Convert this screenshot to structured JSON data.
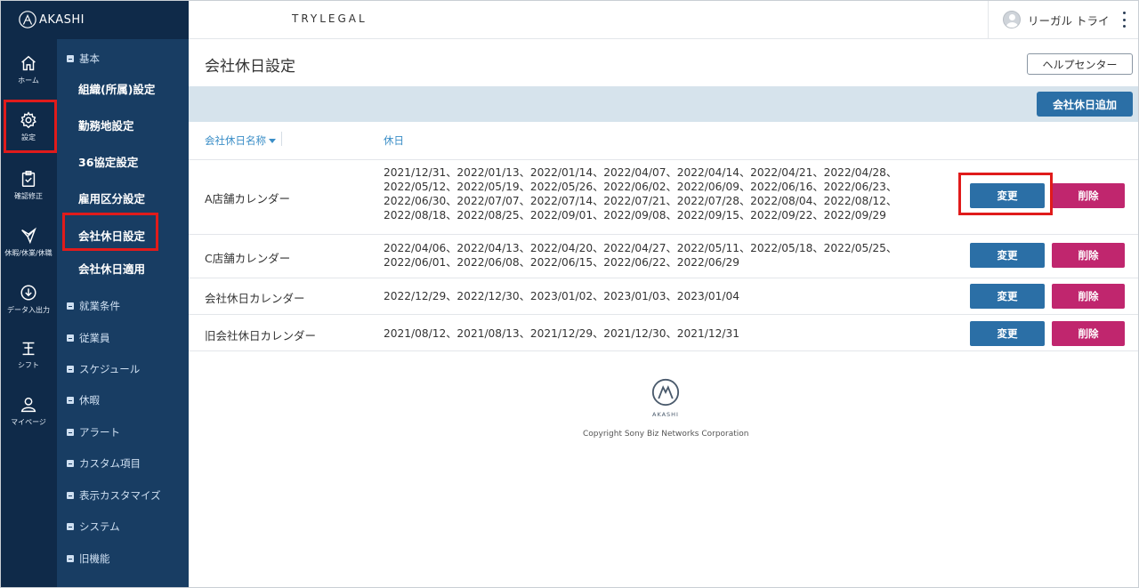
{
  "app": {
    "logo_text": "AKASHI",
    "brand": "TRYLEGAL"
  },
  "user": {
    "name": "リーガル トライ"
  },
  "rail": {
    "items": [
      {
        "label": "ホーム",
        "icon": "home-icon"
      },
      {
        "label": "設定",
        "icon": "gear-icon"
      },
      {
        "label": "確認修正",
        "icon": "clipboard-icon"
      },
      {
        "label": "休暇/休業/休職",
        "icon": "leave-icon"
      },
      {
        "label": "データ入出力",
        "icon": "download-icon"
      },
      {
        "label": "シフト",
        "icon": "shift-icon"
      },
      {
        "label": "マイページ",
        "icon": "person-icon"
      }
    ]
  },
  "sidebar": {
    "basic_section": "基本",
    "basic_items": [
      "組織(所属)設定",
      "勤務地設定",
      "36協定設定",
      "雇用区分設定",
      "会社休日設定",
      "会社休日適用"
    ],
    "sections": [
      "就業条件",
      "従業員",
      "スケジュール",
      "休暇",
      "アラート",
      "カスタム項目",
      "表示カスタマイズ",
      "システム",
      "旧機能"
    ]
  },
  "main": {
    "title": "会社休日設定",
    "help_button": "ヘルプセンター",
    "add_button": "会社休日追加",
    "col_name": "会社休日名称",
    "col_holidays": "休日",
    "edit_label": "変更",
    "delete_label": "削除"
  },
  "rows": [
    {
      "name": "A店舗カレンダー",
      "lines": [
        "2021/12/31、2022/01/13、2022/01/14、2022/04/07、2022/04/14、2022/04/21、2022/04/28、",
        "2022/05/12、2022/05/19、2022/05/26、2022/06/02、2022/06/09、2022/06/16、2022/06/23、",
        "2022/06/30、2022/07/07、2022/07/14、2022/07/21、2022/07/28、2022/08/04、2022/08/12、",
        "2022/08/18、2022/08/25、2022/09/01、2022/09/08、2022/09/15、2022/09/22、2022/09/29"
      ]
    },
    {
      "name": "C店舗カレンダー",
      "lines": [
        "2022/04/06、2022/04/13、2022/04/20、2022/04/27、2022/05/11、2022/05/18、2022/05/25、",
        "2022/06/01、2022/06/08、2022/06/15、2022/06/22、2022/06/29"
      ]
    },
    {
      "name": "会社休日カレンダー",
      "lines": [
        "2022/12/29、2022/12/30、2023/01/02、2023/01/03、2023/01/04"
      ]
    },
    {
      "name": "旧会社休日カレンダー",
      "lines": [
        "2021/08/12、2021/08/13、2021/12/29、2021/12/30、2021/12/31"
      ]
    }
  ],
  "footer": {
    "logo_text": "AKASHI",
    "copyright": "Copyright Sony Biz Networks Corporation"
  },
  "colors": {
    "rail": "#0f2a49",
    "sidebar": "#183d63",
    "primary": "#2b6fa6",
    "danger": "#c0266e",
    "highlight": "#e01b1b"
  }
}
